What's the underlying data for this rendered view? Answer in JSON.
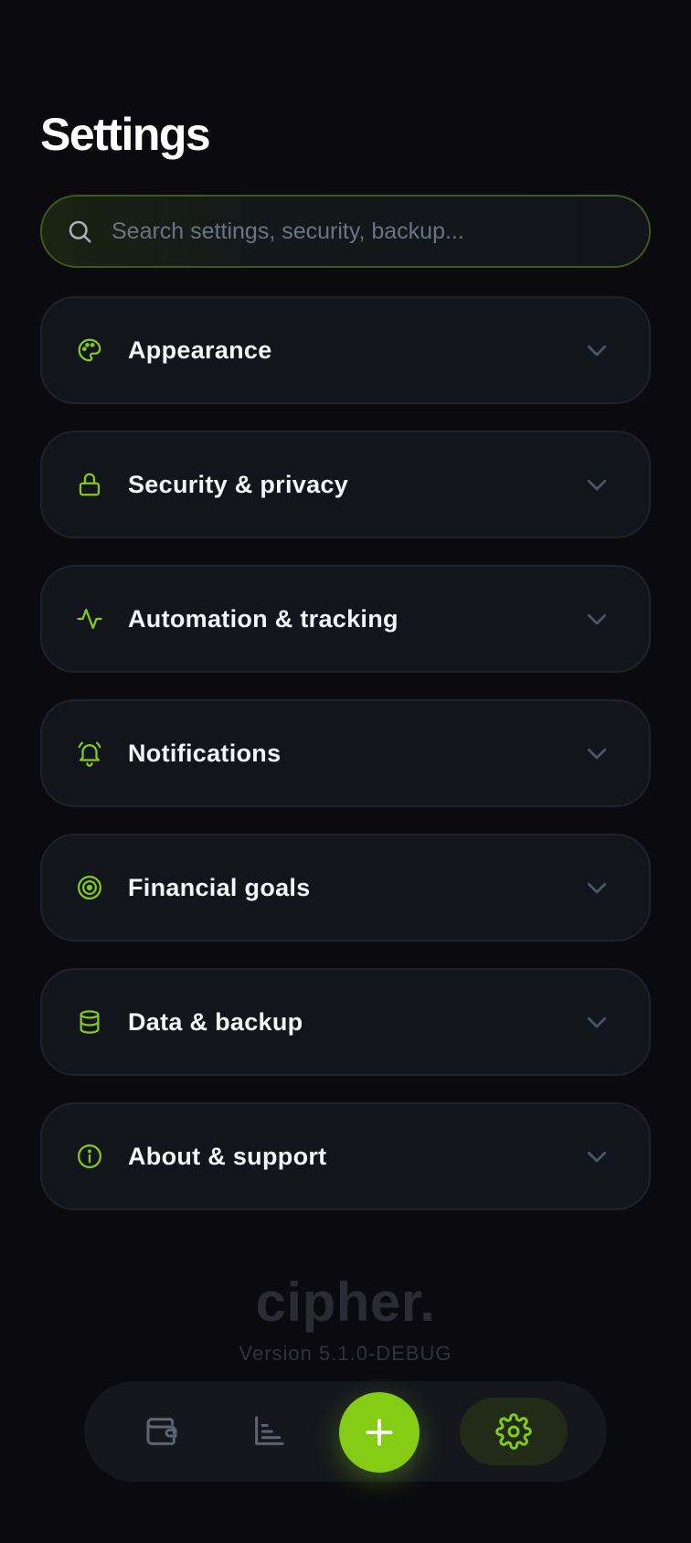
{
  "header": {
    "title": "Settings"
  },
  "search": {
    "placeholder": "Search settings, security, backup..."
  },
  "sections": [
    {
      "label": "Appearance",
      "icon": "palette-icon"
    },
    {
      "label": "Security & privacy",
      "icon": "lock-icon"
    },
    {
      "label": "Automation & tracking",
      "icon": "activity-icon"
    },
    {
      "label": "Notifications",
      "icon": "bell-ringing-icon"
    },
    {
      "label": "Financial goals",
      "icon": "target-icon"
    },
    {
      "label": "Data & backup",
      "icon": "database-icon"
    },
    {
      "label": "About & support",
      "icon": "info-icon"
    }
  ],
  "footer": {
    "brand": "cipher.",
    "version": "Version 5.1.0-DEBUG"
  },
  "bottom_nav": {
    "items": [
      {
        "name": "wallet",
        "icon": "wallet-icon",
        "active": false
      },
      {
        "name": "stats",
        "icon": "bar-chart-icon",
        "active": false
      },
      {
        "name": "add",
        "icon": "plus-icon",
        "active": false
      },
      {
        "name": "settings",
        "icon": "gear-icon",
        "active": true
      }
    ]
  },
  "colors": {
    "accent": "#84cc16",
    "background": "#0b0b0f",
    "card": "#13151c",
    "chevron": "#4a5568"
  }
}
